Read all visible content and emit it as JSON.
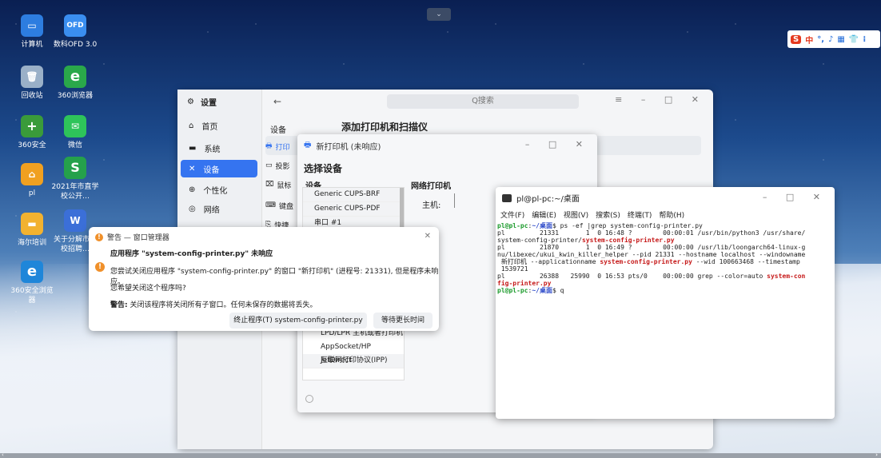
{
  "desktop": {
    "icons": [
      {
        "label": "计算机",
        "color": "#2d7de0",
        "glyph": "▭"
      },
      {
        "label": "数科OFD 3.0",
        "color": "#3a8ef0",
        "glyph": "OFD"
      },
      {
        "label": "回收站",
        "color": "#9ab0c8",
        "glyph": "🗑"
      },
      {
        "label": "360浏览器",
        "color": "#2aa84a",
        "glyph": "e"
      },
      {
        "label": "360安全",
        "color": "#3a9b3a",
        "glyph": "+"
      },
      {
        "label": "微信",
        "color": "#2ec45a",
        "glyph": "✉"
      },
      {
        "label": "pl",
        "color": "#f0a020",
        "glyph": "⌂"
      },
      {
        "label": "2021年市直学校公开…",
        "color": "#25a14b",
        "glyph": "S"
      },
      {
        "label": "海尔培训",
        "color": "#f2b230",
        "glyph": "▬"
      },
      {
        "label": "关于分解市学校招聘…",
        "color": "#3b6fd8",
        "glyph": "W"
      },
      {
        "label": "360安全浏览器",
        "color": "#1f86d9",
        "glyph": "e"
      }
    ],
    "topnotch": "⌄",
    "bottom_left": "‹",
    "bottom_right": "›"
  },
  "ime": {
    "logo": "S",
    "items": [
      "中",
      "°,",
      "♪",
      "▦",
      "👕",
      "⁞"
    ]
  },
  "settings": {
    "app_title": "设置",
    "search_placeholder": "Q搜索",
    "back": "←",
    "controls": "≡ – □ ✕",
    "nav": [
      {
        "icon": "⌂",
        "label": "首页",
        "selected": false
      },
      {
        "icon": "▬",
        "label": "系统",
        "selected": false
      },
      {
        "icon": "✕",
        "label": "设备",
        "selected": true
      },
      {
        "icon": "⊕",
        "label": "个性化",
        "selected": false
      },
      {
        "icon": "◎",
        "label": "网络",
        "selected": false
      }
    ],
    "device_label": "设备",
    "page_title": "添加打印机和扫描仪",
    "subnav": [
      {
        "icon": "🖶",
        "label": "打印"
      },
      {
        "icon": "▭",
        "label": "投影"
      },
      {
        "icon": "⌧",
        "label": "鼠标"
      },
      {
        "icon": "⌨",
        "label": "键盘"
      },
      {
        "icon": "⎘",
        "label": "快捷"
      }
    ]
  },
  "new_printer": {
    "title": "新打印机 (未响应)",
    "controls": "– □ ✕",
    "section": "选择设备",
    "devices_header": "设备",
    "devices": [
      "Generic CUPS-BRF",
      "Generic CUPS-PDF",
      "串口 #1"
    ],
    "devices_lower": [
      "LPD/LPR 主机或者打印机",
      "AppSocket/HP JetDirect",
      "互联网打印协议(IPP)"
    ],
    "network_header": "网络打印机",
    "host_label": "主机:"
  },
  "terminal": {
    "title": "pl@pl-pc:~/桌面",
    "controls": "– □ ✕",
    "menu": [
      "文件(F)",
      "编辑(E)",
      "视图(V)",
      "搜索(S)",
      "终端(T)",
      "帮助(H)"
    ]
  },
  "warning": {
    "title": "警告 — 窗口管理器",
    "close": "✕",
    "heading": "应用程序 \"system-config-printer.py\" 未响应",
    "line1": "您尝试关闭应用程序 \"system-config-printer.py\" 的窗口 \"新打印机\" (进程号: 21331), 但是程序未响应。",
    "line2": "您希望关闭这个程序吗?",
    "warn_bold": "警告:",
    "warn_text": "关闭该程序将关闭所有子窗口。任何未保存的数据将丢失。",
    "btn_terminate": "终止程序(T) system-config-printer.py",
    "btn_wait": "等待更长时间"
  }
}
